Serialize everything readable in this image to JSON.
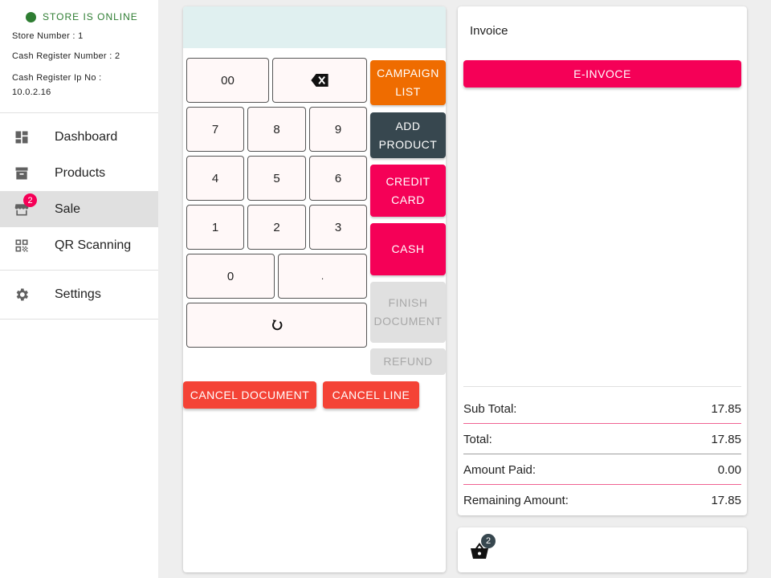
{
  "sidebar": {
    "store_status": "STORE IS ONLINE",
    "store_number": "Store Number : 1",
    "cash_register_number": "Cash Register Number : 2",
    "cash_register_ip_label": "Cash Register Ip No :",
    "cash_register_ip_value": "10.0.2.16",
    "nav": {
      "dashboard": "Dashboard",
      "products": "Products",
      "sale": "Sale",
      "sale_badge": "2",
      "qr_scanning": "QR Scanning",
      "settings": "Settings"
    }
  },
  "keypad": {
    "keys": {
      "k00": "00",
      "k7": "7",
      "k8": "8",
      "k9": "9",
      "k4": "4",
      "k5": "5",
      "k6": "6",
      "k1": "1",
      "k2": "2",
      "k3": "3",
      "k0": "0",
      "kdot": "."
    },
    "actions": {
      "campaign_list": "CAMPAIGN LIST",
      "add_product": "ADD PRODUCT",
      "credit_card": "CREDIT CARD",
      "cash": "CASH",
      "finish_document": "FINISH DOCUMENT",
      "refund": "REFUND"
    },
    "cancel_document": "CANCEL DOCUMENT",
    "cancel_line": "CANCEL LINE"
  },
  "invoice": {
    "title": "Invoice",
    "einvoice_button": "E-INVOCE",
    "sub_total_label": "Sub Total:",
    "sub_total_value": "17.85",
    "total_label": "Total:",
    "total_value": "17.85",
    "amount_paid_label": "Amount Paid:",
    "amount_paid_value": "0.00",
    "remaining_label": "Remaining Amount:",
    "remaining_value": "17.85"
  },
  "basket": {
    "badge": "2"
  },
  "colors": {
    "online_green": "#2e7d32",
    "pink": "#f50057",
    "orange": "#ef6c00",
    "dark": "#37474f",
    "red": "#f44336"
  }
}
